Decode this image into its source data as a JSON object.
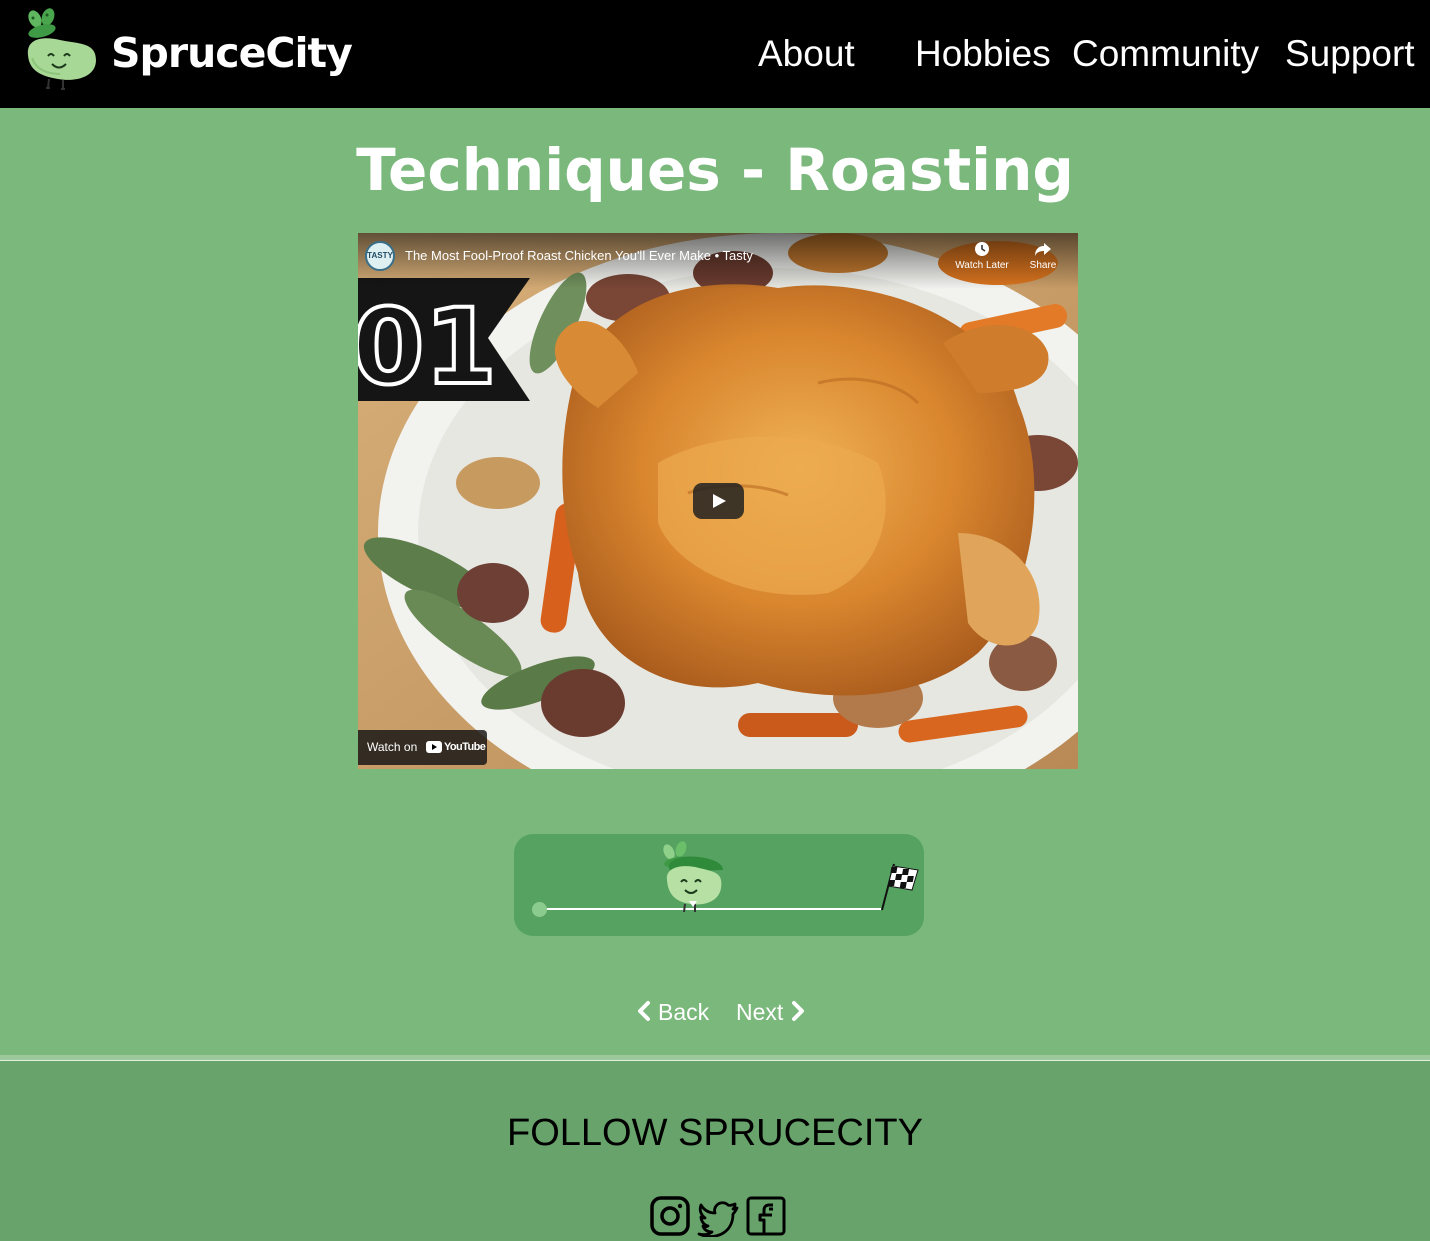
{
  "header": {
    "brand": "SpruceCity",
    "nav": [
      "About",
      "Hobbies",
      "Community",
      "Support"
    ]
  },
  "main": {
    "title": "Techniques - Roasting",
    "video": {
      "title": "The Most Fool-Proof Roast Chicken You'll Ever Make • Tasty",
      "channel_badge": "TASTY",
      "watch_later": "Watch Later",
      "share": "Share",
      "step_badge": "01",
      "watch_on": "Watch on",
      "youtube_wordmark": "YouTube"
    },
    "progress": {
      "fraction_complete": 0.45,
      "start_marker": "start",
      "end_marker": "finish-flag"
    },
    "pagination": {
      "back": "Back",
      "next": "Next"
    }
  },
  "footer": {
    "heading": "FOLLOW SPRUCECITY",
    "social_icons": [
      "instagram-icon",
      "twitter-icon",
      "facebook-icon"
    ]
  },
  "colors": {
    "page_background": "#7ab87c",
    "header_background": "#000000",
    "progress_panel": "#55a261",
    "footer_background": "#67a36b",
    "text_light": "#ffffff",
    "text_dark": "#000000"
  }
}
